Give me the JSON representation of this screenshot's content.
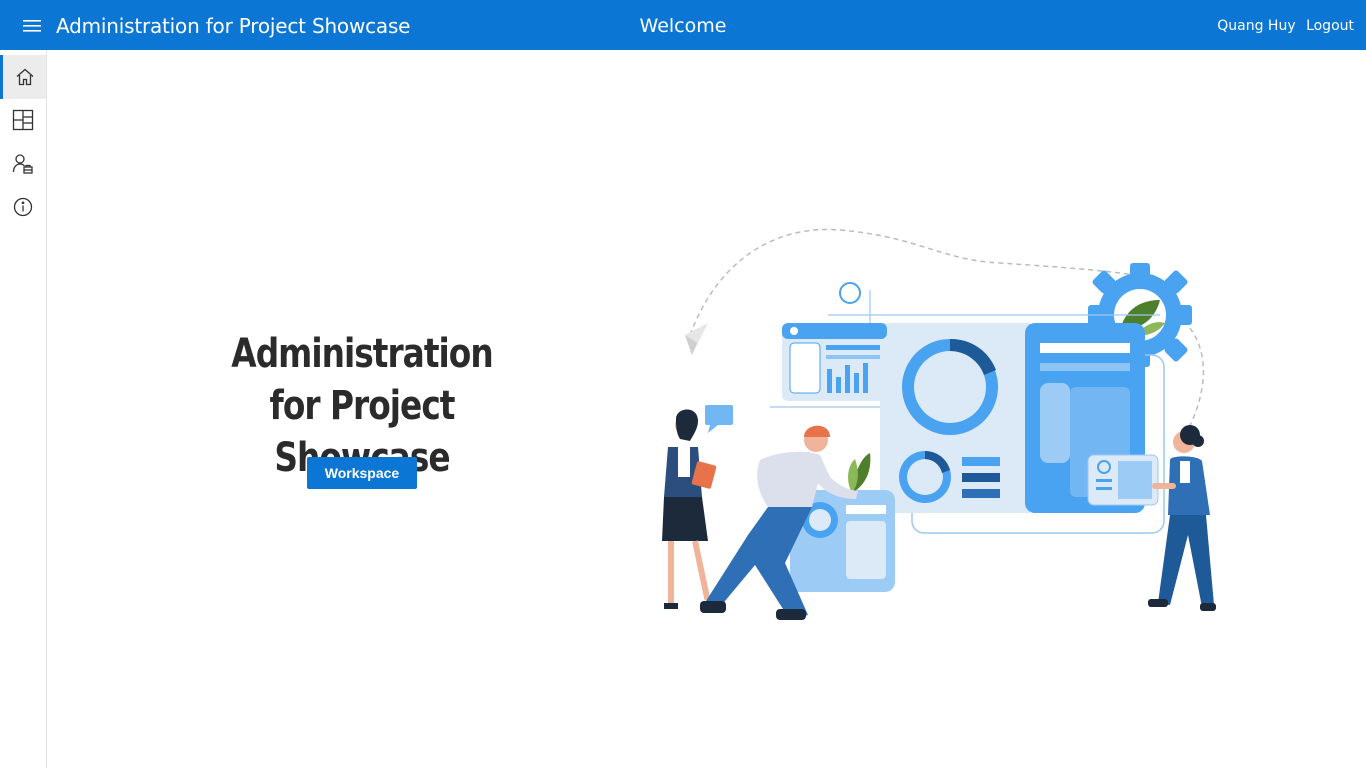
{
  "header": {
    "app_title": "Administration for Project Showcase",
    "page_title": "Welcome",
    "user_name": "Quang Huy",
    "logout_label": "Logout"
  },
  "sidebar": {
    "items": [
      {
        "icon": "home-icon",
        "active": true
      },
      {
        "icon": "dashboard-icon",
        "active": false
      },
      {
        "icon": "user-admin-icon",
        "active": false
      },
      {
        "icon": "info-icon",
        "active": false
      }
    ]
  },
  "hero": {
    "title_line1": "Administration",
    "title_line2": "for Project Showcase",
    "button_label": "Workspace"
  },
  "colors": {
    "accent": "#0B76D3",
    "illustration_blue": "#4AA3F0",
    "illustration_light": "#DCE9F7",
    "illustration_navy": "#1F5A98"
  }
}
